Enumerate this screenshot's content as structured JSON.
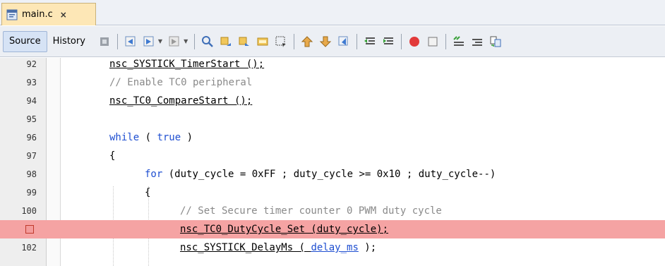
{
  "file_tab": {
    "label": "main.c",
    "close": "×"
  },
  "toolbar": {
    "source_label": "Source",
    "history_label": "History"
  },
  "lines": [
    {
      "num": "92",
      "code": "nsc_SYSTICK_TimerStart ();"
    },
    {
      "num": "93",
      "code": "// Enable TC0 peripheral"
    },
    {
      "num": "94",
      "code": "nsc_TC0_CompareStart ();"
    },
    {
      "num": "95",
      "code": ""
    },
    {
      "num": "96",
      "kw": "while",
      "open": " ( ",
      "val": "true",
      "close": " )"
    },
    {
      "num": "97",
      "code": "{"
    },
    {
      "num": "98",
      "kw": "for",
      "rest": " (duty_cycle = 0xFF ; duty_cycle >= 0x10 ; duty_cycle--)"
    },
    {
      "num": "99",
      "code": "{"
    },
    {
      "num": "100",
      "code": "// Set Secure timer counter 0 PWM duty cycle"
    },
    {
      "num": "",
      "code": "nsc_TC0_DutyCycle_Set (duty_cycle);"
    },
    {
      "num": "102",
      "pre": "nsc_SYSTICK_DelayMs ( ",
      "var": "delay_ms",
      "post": " );"
    }
  ],
  "colors": {
    "breakpoint_highlight": "#f5a3a3",
    "keyword": "#1f4fd1",
    "comment": "#8a8a8a"
  },
  "icons": [
    "file-c-icon",
    "last-edit-icon",
    "back-icon",
    "forward-icon",
    "find-icon",
    "find-prev-icon",
    "find-next-icon",
    "toggle-highlight-icon",
    "toggle-rect-select-icon",
    "prev-bookmark-icon",
    "next-bookmark-icon",
    "toggle-bookmark-icon",
    "shift-left-icon",
    "shift-right-icon",
    "start-macro-icon",
    "stop-macro-icon",
    "comment-icon",
    "uncomment-icon",
    "diff-icon"
  ]
}
